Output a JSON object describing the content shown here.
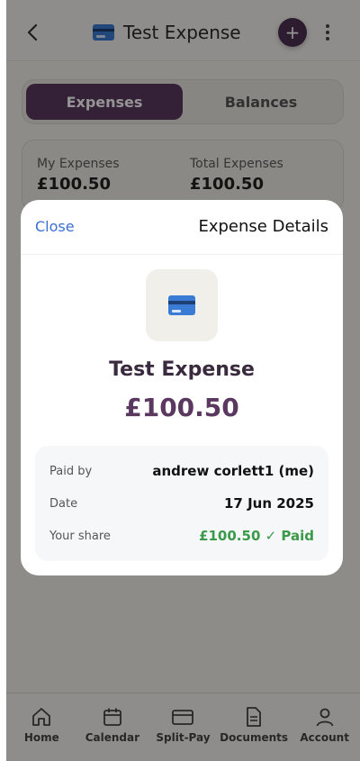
{
  "header": {
    "title": "Test Expense",
    "add_label": "+"
  },
  "tabs": [
    {
      "label": "Expenses",
      "active": true
    },
    {
      "label": "Balances",
      "active": false
    }
  ],
  "summary": {
    "my_label": "My Expenses",
    "my_value": "£100.50",
    "total_label": "Total Expenses",
    "total_value": "£100.50"
  },
  "modal": {
    "close_label": "Close",
    "title": "Expense Details",
    "expense_name": "Test Expense",
    "amount": "£100.50",
    "details": {
      "paid_by_label": "Paid by",
      "paid_by_value": "andrew corlett1 (me)",
      "date_label": "Date",
      "date_value": "17 Jun 2025",
      "share_label": "Your share",
      "share_value": "£100.50 ✓ Paid"
    }
  },
  "bottom_nav": [
    {
      "label": "Home",
      "icon": "home-icon"
    },
    {
      "label": "Calendar",
      "icon": "calendar-icon"
    },
    {
      "label": "Split-Pay",
      "icon": "card-icon"
    },
    {
      "label": "Documents",
      "icon": "document-icon"
    },
    {
      "label": "Account",
      "icon": "user-icon"
    }
  ],
  "colors": {
    "accent": "#5a385f",
    "link": "#3b6fd1",
    "paid_green": "#3a9a4a"
  }
}
